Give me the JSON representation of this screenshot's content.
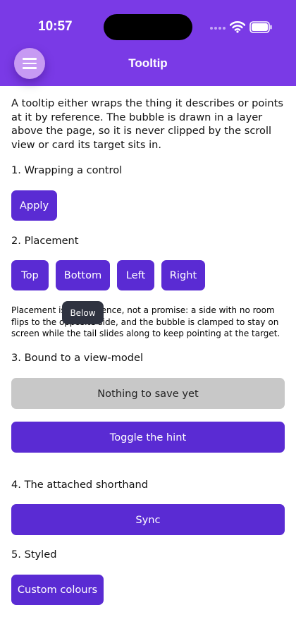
{
  "status_bar": {
    "time": "10:57"
  },
  "header": {
    "title": "Tooltip"
  },
  "intro": "A tooltip either wraps the thing it describes or points at it by reference. The bubble is drawn in a layer above the page, so it is never clipped by the scroll view or card its target sits in.",
  "sections": {
    "wrapping": {
      "label": "1. Wrapping a control",
      "button": "Apply"
    },
    "placement": {
      "label": "2. Placement",
      "buttons": [
        "Top",
        "Bottom",
        "Left",
        "Right"
      ],
      "note": "Placement is a preference, not a promise: a side with no room flips to the opposite side, and the bubble is clamped to stay on screen while the tail slides along to keep pointing at the target.",
      "tooltip": "Below"
    },
    "viewmodel": {
      "label": "3. Bound to a view-model",
      "status_button": "Nothing to save yet",
      "toggle_button": "Toggle the hint"
    },
    "shorthand": {
      "label": "4. The attached shorthand",
      "button": "Sync"
    },
    "styled": {
      "label": "5. Styled",
      "button": "Custom colours"
    }
  }
}
